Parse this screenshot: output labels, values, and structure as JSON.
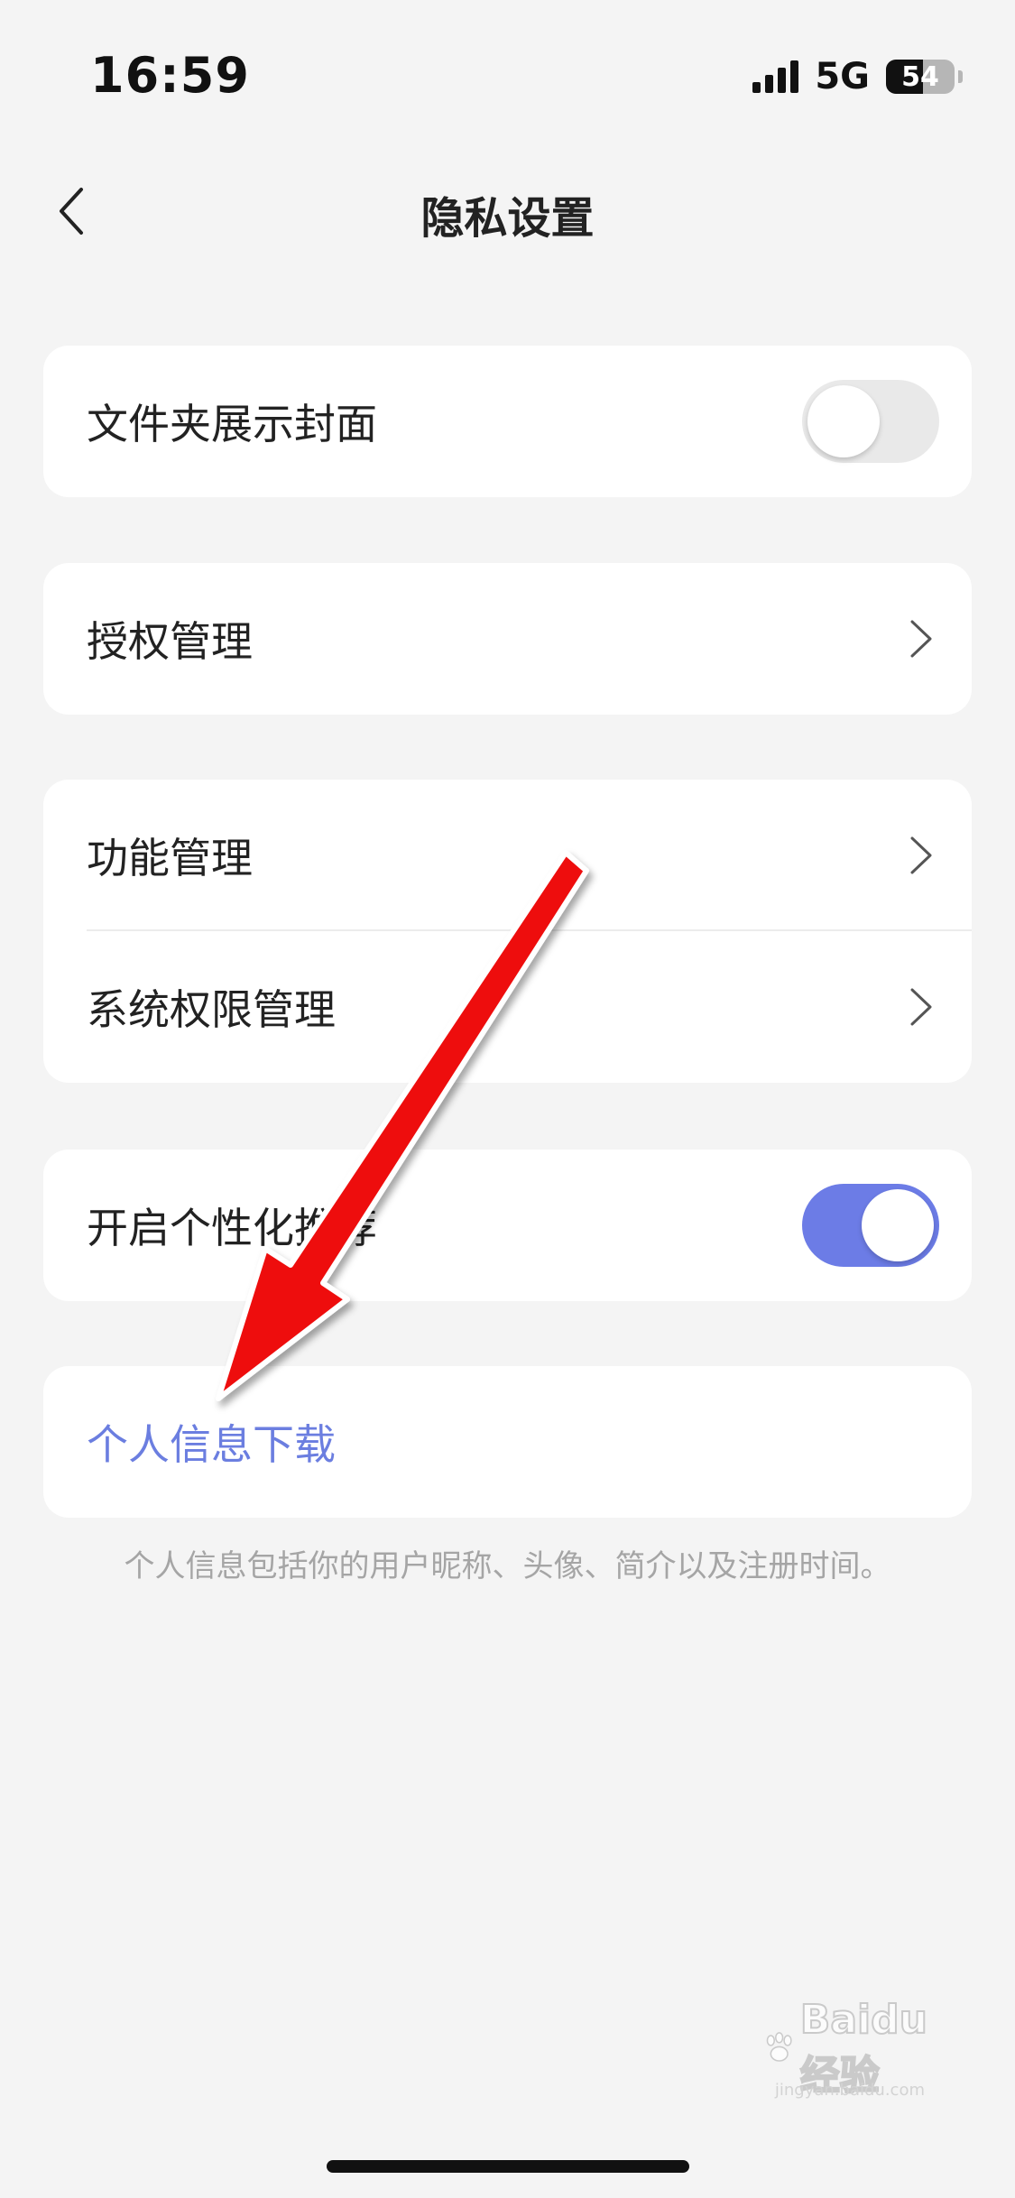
{
  "status_bar": {
    "time": "16:59",
    "network": "5G",
    "battery_level": "54",
    "battery_fraction": 0.54
  },
  "nav": {
    "title": "隐私设置",
    "back_icon": "chevron-left-icon"
  },
  "settings": {
    "folder_cover": {
      "label": "文件夹展示封面",
      "enabled": false
    },
    "authorization": {
      "label": "授权管理"
    },
    "features": {
      "label": "功能管理"
    },
    "system_permissions": {
      "label": "系统权限管理"
    },
    "personalized_recommendation": {
      "label": "开启个性化推荐",
      "enabled": true
    },
    "personal_info_download": {
      "label": "个人信息下载",
      "footnote": "个人信息包括你的用户昵称、头像、简介以及注册时间。"
    }
  },
  "colors": {
    "background": "#f4f4f4",
    "card": "#ffffff",
    "accent": "#6c7ce6",
    "link": "#6b7ee0",
    "annotation_arrow": "#ee1111"
  },
  "watermark": {
    "text": "Baidu经验",
    "sub": "jingyan.baidu.com"
  }
}
